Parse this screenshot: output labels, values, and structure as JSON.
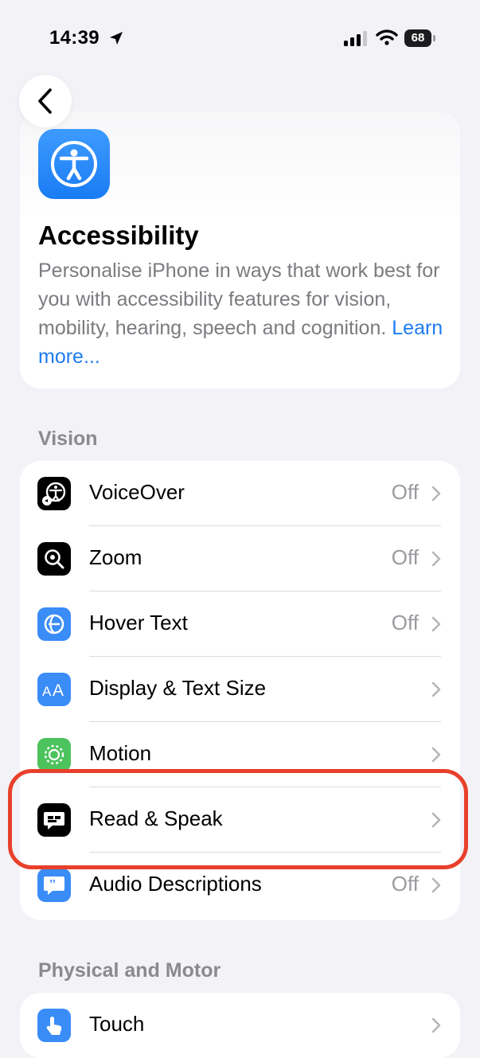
{
  "status_bar": {
    "time": "14:39",
    "battery": "68"
  },
  "header": {
    "title": "Accessibility",
    "description": "Personalise iPhone in ways that work best for you with accessibility features for vision, mobility, hearing, speech and cognition. ",
    "link": "Learn more..."
  },
  "vision": {
    "title": "Vision",
    "rows": [
      {
        "label": "VoiceOver",
        "value": "Off",
        "icon": "voiceover-icon"
      },
      {
        "label": "Zoom",
        "value": "Off",
        "icon": "zoom-icon"
      },
      {
        "label": "Hover Text",
        "value": "Off",
        "icon": "hover-text-icon"
      },
      {
        "label": "Display & Text Size",
        "value": "",
        "icon": "text-size-icon"
      },
      {
        "label": "Motion",
        "value": "",
        "icon": "motion-icon"
      },
      {
        "label": "Read & Speak",
        "value": "",
        "icon": "speech-bubble-icon"
      },
      {
        "label": "Audio Descriptions",
        "value": "Off",
        "icon": "quote-bubble-icon"
      }
    ]
  },
  "physical": {
    "title": "Physical and Motor",
    "rows": [
      {
        "label": "Touch",
        "value": "",
        "icon": "touch-hand-icon"
      }
    ]
  },
  "colors": {
    "accent": "#1e7cf4",
    "highlight": "#e8402b"
  }
}
